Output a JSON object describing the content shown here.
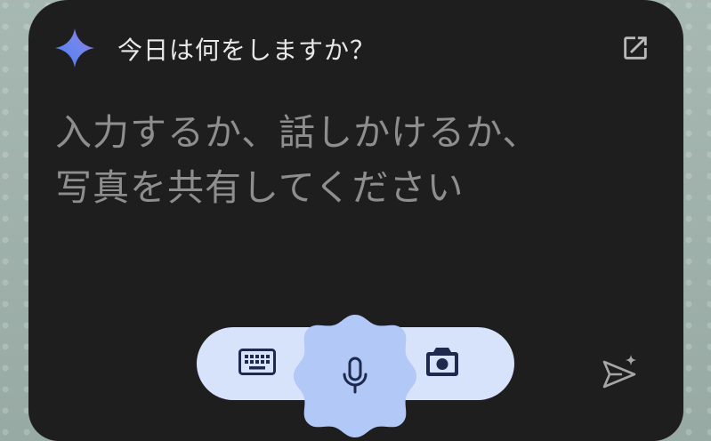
{
  "header": {
    "title": "今日は何をしますか？",
    "sparkle_icon": "gemini-sparkle-icon",
    "open_icon": "open-in-new-icon"
  },
  "prompt": {
    "line1": "入力するか、話しかけるか、",
    "line2": "写真を共有してください"
  },
  "toolbar": {
    "keyboard_icon": "keyboard-icon",
    "mic_icon": "microphone-icon",
    "camera_icon": "camera-icon",
    "send_icon": "send-sparkle-icon"
  },
  "colors": {
    "panel_bg": "#1e1e1e",
    "title_text": "#e8e8e8",
    "placeholder_text": "#8e8e8e",
    "toolbar_bg": "#d7e2fb",
    "mic_blob": "#b2c8f6",
    "icon_dark": "#1d2a4d",
    "sparkle_blue": "#4f7cf0",
    "sparkle_purple": "#9a73d8"
  }
}
